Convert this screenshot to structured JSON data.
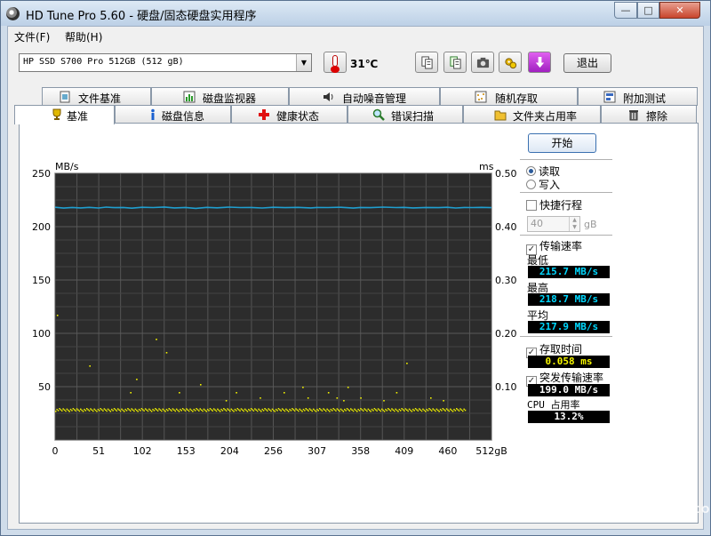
{
  "window": {
    "title": "HD Tune Pro 5.60 - 硬盘/固态硬盘实用程序",
    "min_glyph": "—",
    "max_glyph": "□",
    "close_glyph": "✕"
  },
  "menu": {
    "file": "文件(F)",
    "help": "帮助(H)"
  },
  "toolbar": {
    "drive": "HP SSD S700 Pro 512GB (512 gB)",
    "drive_arrow": "▼",
    "temperature": "31℃",
    "exit_label": "退出",
    "icons": [
      "copy-icon",
      "copy-icon",
      "camera-icon",
      "settings-icon",
      "download-icon"
    ]
  },
  "tabs": {
    "back": [
      {
        "label": "文件基准",
        "icon": "file-benchmark-icon"
      },
      {
        "label": "磁盘监视器",
        "icon": "disk-monitor-icon"
      },
      {
        "label": "自动噪音管理",
        "icon": "speaker-icon"
      },
      {
        "label": "随机存取",
        "icon": "random-access-icon"
      },
      {
        "label": "附加测试",
        "icon": "extra-tests-icon"
      }
    ],
    "front": [
      {
        "label": "基准",
        "icon": "trophy-icon"
      },
      {
        "label": "磁盘信息",
        "icon": "info-icon"
      },
      {
        "label": "健康状态",
        "icon": "health-cross-icon"
      },
      {
        "label": "错误扫描",
        "icon": "magnifier-icon"
      },
      {
        "label": "文件夹占用率",
        "icon": "folder-icon"
      },
      {
        "label": "擦除",
        "icon": "trash-icon"
      }
    ],
    "active": "基准"
  },
  "controls": {
    "start_label": "开始",
    "read_label": "读取",
    "write_label": "写入",
    "read_selected": true,
    "quick_label": "快捷行程",
    "quick_checked": false,
    "quick_value": "40",
    "quick_unit": "gB",
    "transfer_label": "传输速率",
    "transfer_checked": true,
    "min_label": "最低",
    "min_value": "215.7 MB/s",
    "max_label": "最高",
    "max_value": "218.7 MB/s",
    "avg_label": "平均",
    "avg_value": "217.9 MB/s",
    "access_label": "存取时间",
    "access_checked": true,
    "access_value": "0.058 ms",
    "burst_label": "突发传输速率",
    "burst_checked": true,
    "burst_value": "199.0 MB/s",
    "cpu_label": "CPU 占用率",
    "cpu_value": "13.2%",
    "check_glyph": "✓"
  },
  "watermark": {
    "text": "小设天下",
    "sub": "WWW.WSTX.COM"
  },
  "chart_data": {
    "type": "line",
    "y_left_label": "MB/s",
    "y_right_label": "ms",
    "y_left_ticks": [
      "250",
      "200",
      "150",
      "100",
      "50"
    ],
    "y_right_ticks": [
      "0.50",
      "0.40",
      "0.30",
      "0.20",
      "0.10"
    ],
    "x_ticks": [
      "0",
      "51",
      "102",
      "153",
      "204",
      "256",
      "307",
      "358",
      "409",
      "460",
      "512gB"
    ],
    "xlim": [
      0,
      512
    ],
    "ylim_left": [
      0,
      250
    ],
    "ylim_right": [
      0,
      0.5
    ],
    "grid": true,
    "series": [
      {
        "kind": "line",
        "color": "#1f9fd0",
        "x": [
          0,
          10,
          20,
          30,
          40,
          51,
          60,
          70,
          80,
          90,
          102,
          115,
          128,
          140,
          153,
          165,
          178,
          190,
          204,
          217,
          230,
          243,
          256,
          270,
          285,
          300,
          307,
          320,
          335,
          350,
          358,
          370,
          385,
          400,
          409,
          420,
          435,
          450,
          460,
          470,
          480,
          490,
          500,
          512
        ],
        "y": [
          218.2,
          217.4,
          218.0,
          217.6,
          218.1,
          217.5,
          218.3,
          217.8,
          218.0,
          217.3,
          218.2,
          217.9,
          218.4,
          217.6,
          218.0,
          217.2,
          218.1,
          217.7,
          218.3,
          217.9,
          218.0,
          217.5,
          218.2,
          217.8,
          218.1,
          217.6,
          218.0,
          217.9,
          218.2,
          217.4,
          218.0,
          217.8,
          218.3,
          217.9,
          218.1,
          217.6,
          218.0,
          217.8,
          218.2,
          217.5,
          218.0,
          217.9,
          218.1,
          217.8
        ]
      },
      {
        "kind": "scatter",
        "color": "#f0f000",
        "band_ms": [
          0.055,
          0.06
        ],
        "x": [
          2,
          40,
          88,
          95,
          118,
          130,
          145,
          170,
          200,
          212,
          240,
          268,
          290,
          296,
          320,
          330,
          338,
          343,
          358,
          385,
          400,
          412,
          440,
          455
        ],
        "y": [
          0.235,
          0.14,
          0.09,
          0.115,
          0.19,
          0.165,
          0.09,
          0.105,
          0.075,
          0.09,
          0.08,
          0.09,
          0.1,
          0.08,
          0.09,
          0.08,
          0.075,
          0.1,
          0.08,
          0.075,
          0.09,
          0.145,
          0.08,
          0.075
        ]
      }
    ]
  }
}
